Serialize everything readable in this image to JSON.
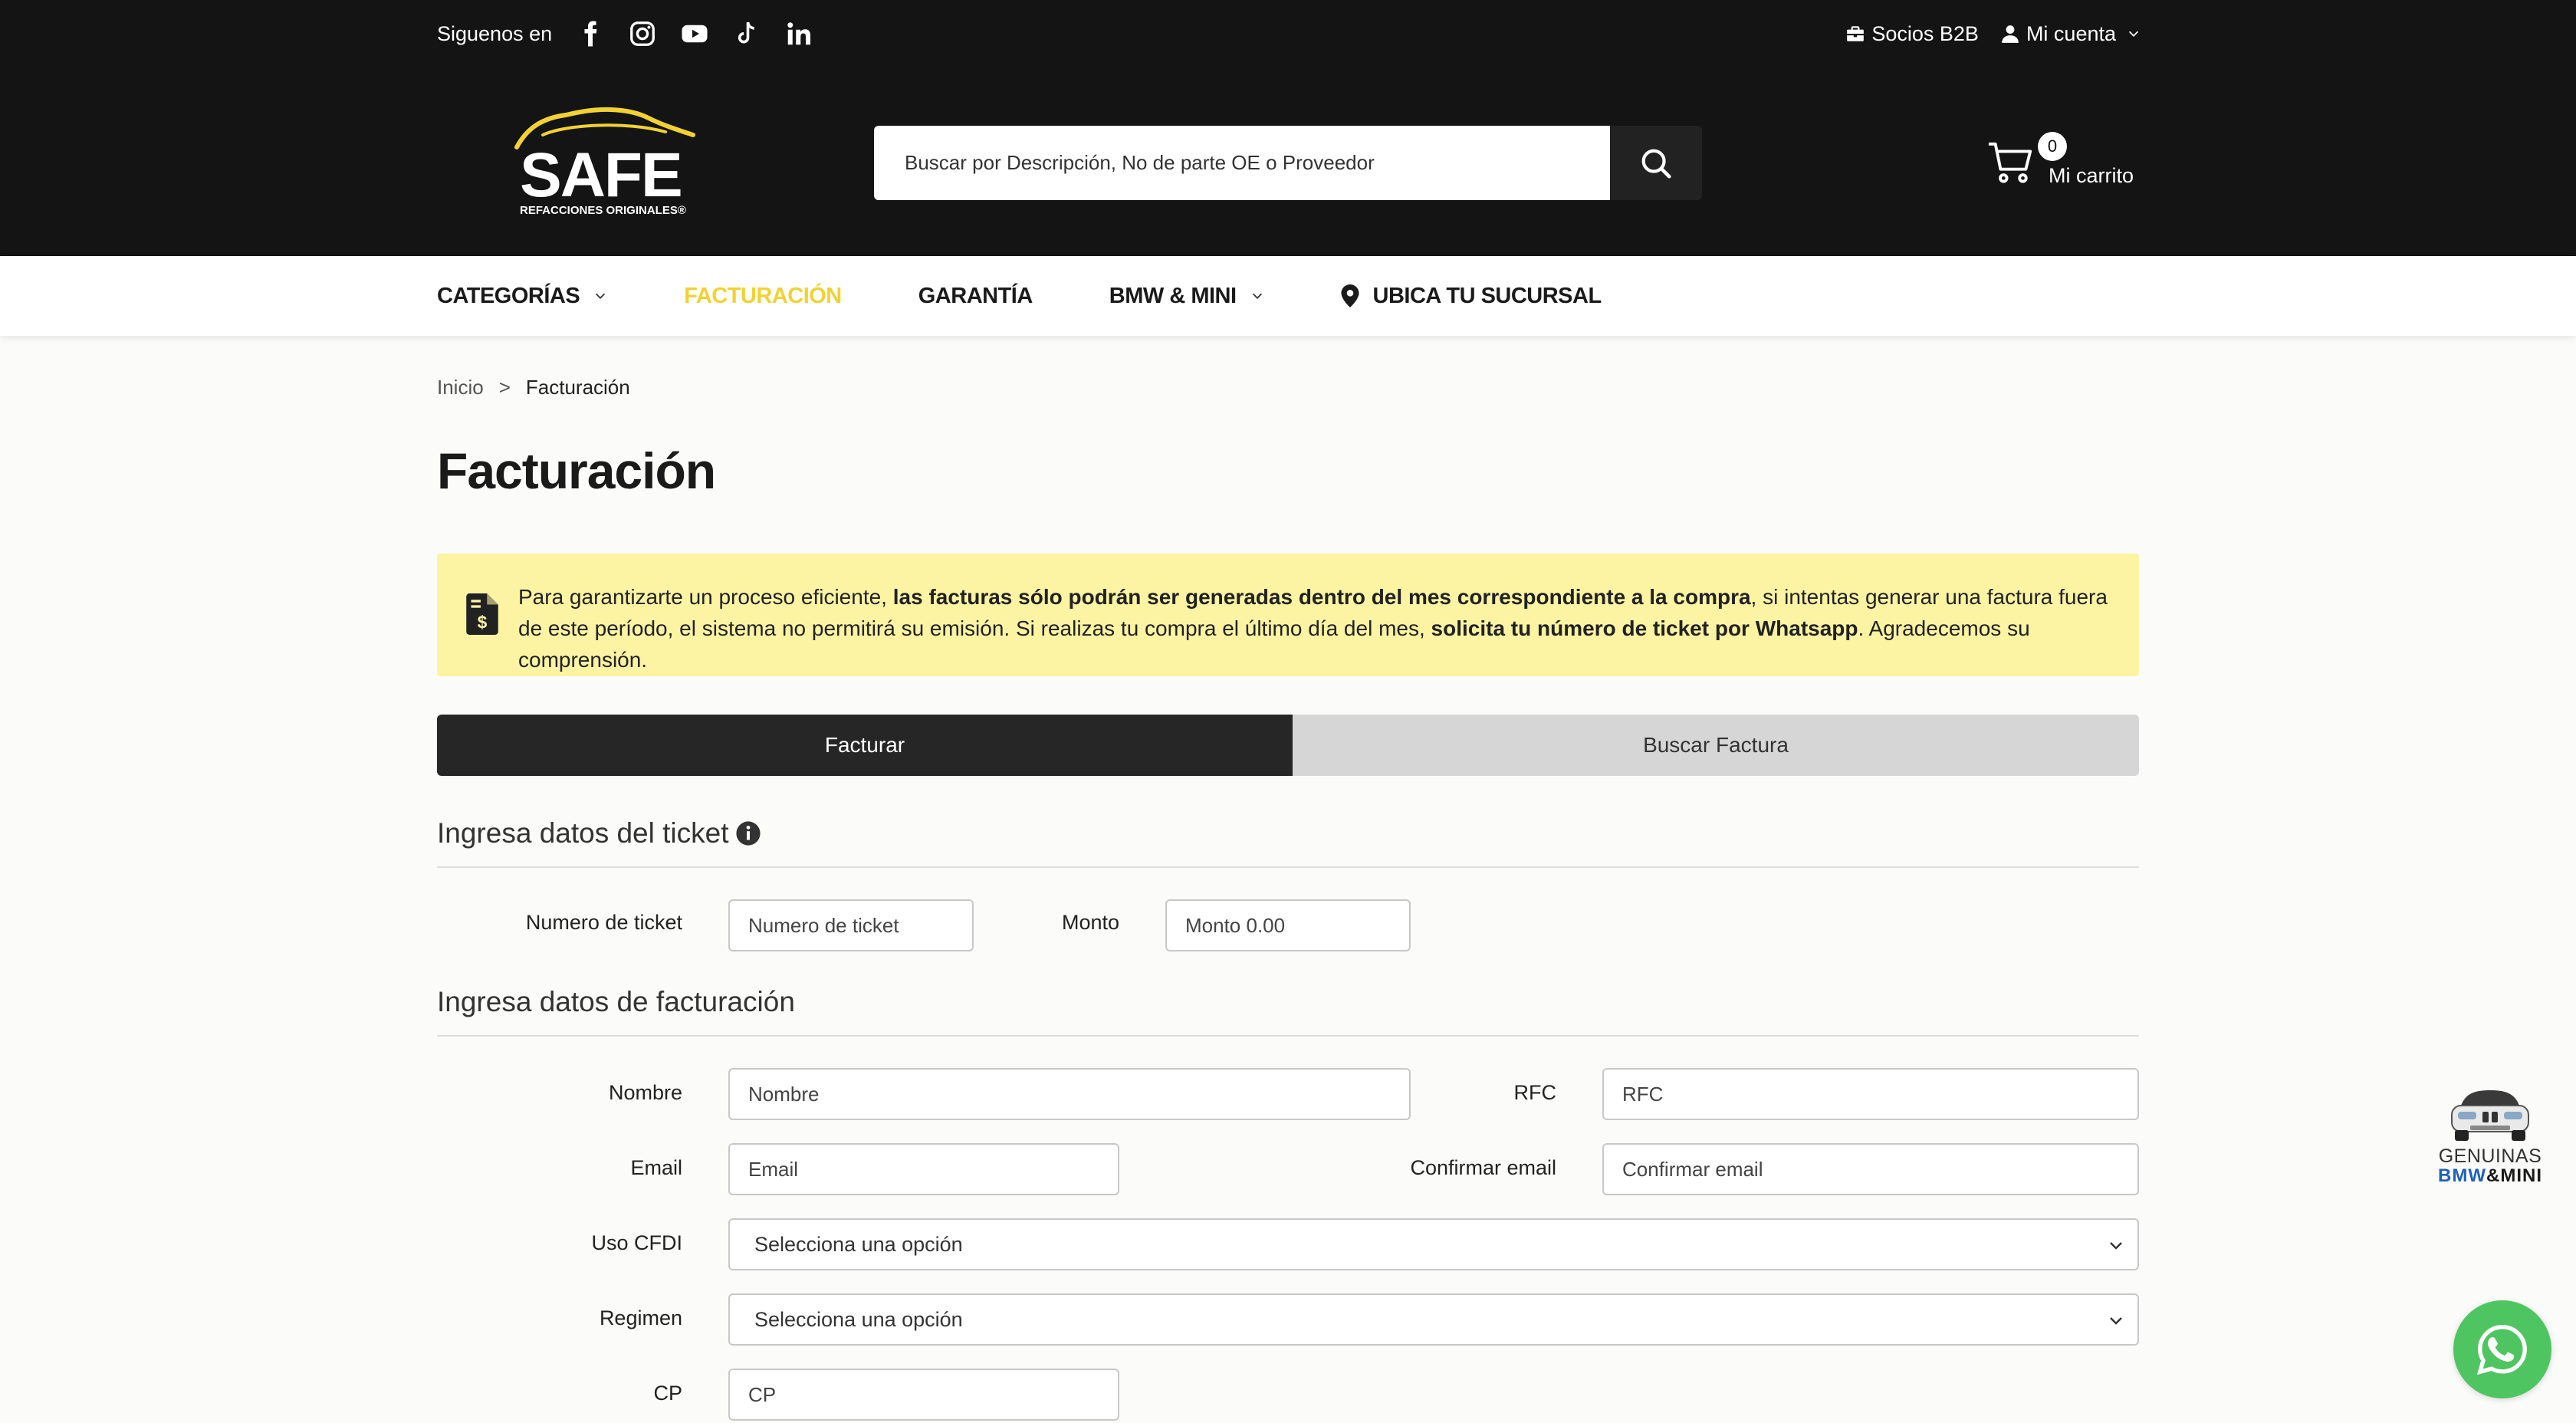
{
  "topbar": {
    "follow_label": "Siguenos en",
    "social_icons": [
      "facebook-icon",
      "instagram-icon",
      "youtube-icon",
      "tiktok-icon",
      "linkedin-icon"
    ],
    "b2b_label": "Socios B2B",
    "account_label": "Mi cuenta"
  },
  "logo": {
    "word": "SAFE",
    "tagline": "REFACCIONES ORIGINALES®"
  },
  "search": {
    "placeholder": "Buscar por Descripción, No de parte OE o Proveedor"
  },
  "cart": {
    "count": "0",
    "label": "Mi carrito"
  },
  "nav": {
    "items": [
      {
        "label": "CATEGORÍAS",
        "dropdown": true
      },
      {
        "label": "FACTURACIÓN",
        "active": true
      },
      {
        "label": "GARANTÍA"
      },
      {
        "label": "BMW & MINI",
        "dropdown": true
      },
      {
        "label": "UBICA TU SUCURSAL",
        "icon": "map-pin-icon"
      }
    ]
  },
  "breadcrumb": {
    "home": "Inicio",
    "separator": ">",
    "current": "Facturación"
  },
  "page_title": "Facturación",
  "notice": {
    "t1": "Para garantizarte un proceso eficiente, ",
    "b1": "las facturas sólo podrán ser generadas dentro del mes correspondiente a la compra",
    "t2": ", si intentas generar una factura fuera de este período, el sistema no permitirá su emisión. Si realizas tu compra el último día del mes, ",
    "b2": "solicita tu número de ticket por Whatsapp",
    "t3": ". Agradecemos su comprensión."
  },
  "tabs": {
    "active": "Facturar",
    "inactive": "Buscar Factura"
  },
  "ticket_section": {
    "heading": "Ingresa datos del ticket",
    "ticket_label": "Numero de ticket",
    "ticket_placeholder": "Numero de ticket",
    "amount_label": "Monto",
    "amount_placeholder": "Monto 0.00"
  },
  "billing_section": {
    "heading": "Ingresa datos de facturación",
    "name_label": "Nombre",
    "name_placeholder": "Nombre",
    "rfc_label": "RFC",
    "rfc_placeholder": "RFC",
    "email_label": "Email",
    "email_placeholder": "Email",
    "confirm_label": "Confirmar email",
    "confirm_placeholder": "Confirmar email",
    "cfdi_label": "Uso CFDI",
    "cfdi_value": "Selecciona una opción",
    "regimen_label": "Regimen",
    "regimen_value": "Selecciona una opción",
    "cp_label": "CP",
    "cp_placeholder": "CP"
  },
  "floating": {
    "genuinas_line1": "GENUINAS",
    "genuinas_bmw": "BMW",
    "genuinas_amp": "&",
    "genuinas_mini": "MINI"
  },
  "colors": {
    "accent": "#f2d233",
    "topbar": "#141414",
    "notice": "#fdf4a3",
    "whatsapp": "#4fc561"
  }
}
